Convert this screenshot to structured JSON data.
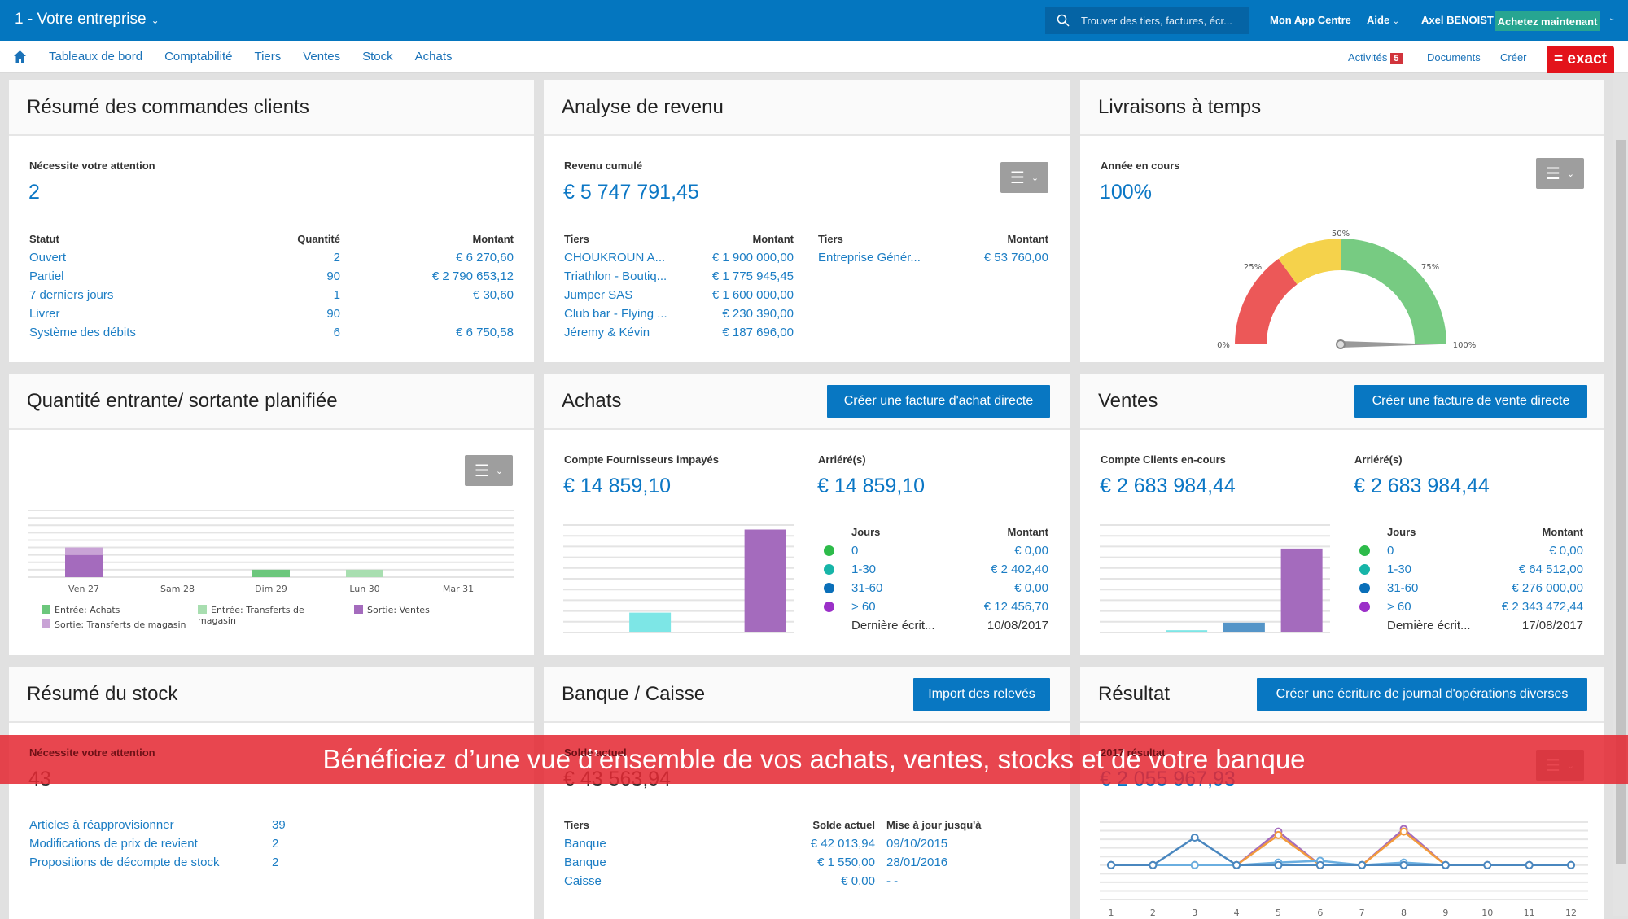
{
  "topbar": {
    "company": "1 - Votre entreprise",
    "search_placeholder": "Trouver des tiers, factures, écr...",
    "app_centre": "Mon App Centre",
    "help": "Aide",
    "user": "Axel BENOIST",
    "buy": "Achetez maintenant"
  },
  "nav": {
    "items": [
      "Tableaux de bord",
      "Comptabilité",
      "Tiers",
      "Ventes",
      "Stock",
      "Achats"
    ],
    "activities": "Activités",
    "activities_count": "5",
    "documents": "Documents",
    "create": "Créer",
    "logo": "= exact"
  },
  "orders": {
    "title": "Résumé des commandes clients",
    "label": "Nécessite votre attention",
    "value": "2",
    "headers": [
      "Statut",
      "Quantité",
      "Montant"
    ],
    "rows": [
      {
        "status": "Ouvert",
        "qty": "2",
        "amount": "€ 6 270,60"
      },
      {
        "status": "Partiel",
        "qty": "90",
        "amount": "€ 2 790 653,12"
      },
      {
        "status": "7 derniers jours",
        "qty": "1",
        "amount": "€ 30,60"
      },
      {
        "status": "Livrer",
        "qty": "90",
        "amount": ""
      },
      {
        "status": "Système des débits",
        "qty": "6",
        "amount": "€ 6 750,58"
      }
    ]
  },
  "revenue": {
    "title": "Analyse de revenu",
    "label": "Revenu cumulé",
    "value": "€ 5 747 791,45",
    "headers": [
      "Tiers",
      "Montant"
    ],
    "left": [
      {
        "name": "CHOUKROUN A...",
        "amount": "€ 1 900 000,00"
      },
      {
        "name": "Triathlon - Boutiq...",
        "amount": "€ 1 775 945,45"
      },
      {
        "name": "Jumper SAS",
        "amount": "€ 1 600 000,00"
      },
      {
        "name": "Club bar - Flying ...",
        "amount": "€ 230 390,00"
      },
      {
        "name": "Jéremy & Kévin",
        "amount": "€ 187 696,00"
      }
    ],
    "right": [
      {
        "name": "Entreprise Génér...",
        "amount": "€ 53 760,00"
      }
    ]
  },
  "delivery": {
    "title": "Livraisons à temps",
    "label": "Année en cours",
    "value": "100%",
    "gauge": {
      "value": 100,
      "ticks": [
        "0%",
        "25%",
        "50%",
        "75%",
        "100%"
      ],
      "segments": [
        {
          "from": 0,
          "to": 30,
          "color": "#ec5858"
        },
        {
          "from": 30,
          "to": 50,
          "color": "#f5d24b"
        },
        {
          "from": 50,
          "to": 100,
          "color": "#77cb82"
        }
      ]
    }
  },
  "planned": {
    "title": "Quantité entrante/ sortante planifiée",
    "legend": [
      "Entrée: Achats",
      "Entrée: Transferts de magasin",
      "Sortie: Ventes",
      "Sortie: Transferts de magasin"
    ]
  },
  "purchases": {
    "title": "Achats",
    "button": "Créer une facture d'achat directe",
    "label": "Compte Fournisseurs impayés",
    "value": "€ 14 859,10",
    "overdue_label": "Arriéré(s)",
    "overdue_value": "€ 14 859,10",
    "headers": [
      "Jours",
      "Montant"
    ],
    "rows": [
      {
        "days": "0",
        "amount": "€ 0,00"
      },
      {
        "days": "1-30",
        "amount": "€ 2 402,40"
      },
      {
        "days": "31-60",
        "amount": "€ 0,00"
      },
      {
        "days": "> 60",
        "amount": "€ 12 456,70"
      }
    ],
    "last_label": "Dernière écrit...",
    "last_date": "10/08/2017"
  },
  "sales": {
    "title": "Ventes",
    "button": "Créer une facture de vente directe",
    "label": "Compte Clients en-cours",
    "value": "€ 2 683 984,44",
    "overdue_label": "Arriéré(s)",
    "overdue_value": "€ 2 683 984,44",
    "headers": [
      "Jours",
      "Montant"
    ],
    "rows": [
      {
        "days": "0",
        "amount": "€ 0,00"
      },
      {
        "days": "1-30",
        "amount": "€ 64 512,00"
      },
      {
        "days": "31-60",
        "amount": "€ 276 000,00"
      },
      {
        "days": "> 60",
        "amount": "€ 2 343 472,44"
      }
    ],
    "last_label": "Dernière écrit...",
    "last_date": "17/08/2017"
  },
  "aging_colors": [
    "#2dbb4a",
    "#17b5a8",
    "#0a6fb9",
    "#9b30c8"
  ],
  "stock": {
    "title": "Résumé du stock",
    "label": "Nécessite votre attention",
    "value": "43",
    "rows": [
      {
        "name": "Articles à réapprovisionner",
        "count": "39"
      },
      {
        "name": "Modifications de prix de revient",
        "count": "2"
      },
      {
        "name": "Propositions de décompte de stock",
        "count": "2"
      }
    ]
  },
  "bank": {
    "title": "Banque / Caisse",
    "button": "Import des relevés",
    "label": "Solde actuel",
    "value": "€ 43 563,94",
    "headers": [
      "Tiers",
      "Solde actuel",
      "Mise à jour jusqu'à"
    ],
    "rows": [
      {
        "name": "Banque",
        "balance": "€ 42 013,94",
        "date": "09/10/2015"
      },
      {
        "name": "Banque",
        "balance": "€ 1 550,00",
        "date": "28/01/2016"
      },
      {
        "name": "Caisse",
        "balance": "€ 0,00",
        "date": "- -"
      }
    ]
  },
  "result": {
    "title": "Résultat",
    "button": "Créer une écriture de journal d'opérations diverses",
    "label": "2017 résultat",
    "value": "€ 2 055 967,93"
  },
  "banner": "Bénéficiez d’une vue d’ensemble de vos achats, ventes, stocks et de votre banque",
  "chart_data": [
    {
      "type": "bar",
      "stacked": true,
      "categories": [
        "Ven 27",
        "Sam 28",
        "Dim 29",
        "Lun 30",
        "Mar 31"
      ],
      "ylim": [
        0,
        9
      ],
      "grid": true,
      "series": [
        {
          "name": "Entrée: Achats",
          "color": "#6cc77c",
          "values": [
            0,
            0,
            1,
            0,
            0
          ]
        },
        {
          "name": "Entrée: Transferts de magasin",
          "color": "#a8deb0",
          "values": [
            0,
            0,
            0,
            1,
            0
          ]
        },
        {
          "name": "Sortie: Ventes",
          "color": "#a46bbd",
          "values": [
            3,
            0,
            0,
            0,
            0
          ]
        },
        {
          "name": "Sortie: Transferts de magasin",
          "color": "#c9a3d6",
          "values": [
            1,
            0,
            0,
            0,
            0
          ]
        }
      ]
    },
    {
      "type": "bar",
      "title": "Achats - arriérés",
      "categories": [
        "0",
        "1-30",
        "31-60",
        "> 60"
      ],
      "values": [
        0,
        2402.4,
        0,
        12456.7
      ],
      "colors": [
        "#2dbb4a",
        "#7de6e6",
        "#5595c8",
        "#a46bbd"
      ],
      "ylim": [
        0,
        13000
      ],
      "grid": true
    },
    {
      "type": "bar",
      "title": "Ventes - arriérés",
      "categories": [
        "0",
        "1-30",
        "31-60",
        "> 60"
      ],
      "values": [
        0,
        64512,
        276000,
        2343472.44
      ],
      "colors": [
        "#2dbb4a",
        "#7de6e6",
        "#5595c8",
        "#a46bbd"
      ],
      "ylim": [
        0,
        3000000
      ],
      "grid": true
    },
    {
      "type": "line",
      "x": [
        1,
        2,
        3,
        4,
        5,
        6,
        7,
        8,
        9,
        10,
        11,
        12
      ],
      "ylim": [
        -4,
        5
      ],
      "grid": true,
      "series": [
        {
          "color": "#a46bbd",
          "values": [
            0,
            0,
            0,
            0,
            3.9,
            0,
            0,
            4.2,
            0,
            0,
            0,
            0
          ]
        },
        {
          "color": "#f29b3d",
          "values": [
            0,
            0,
            0,
            0,
            3.5,
            0,
            0,
            3.9,
            0,
            0,
            0,
            0
          ]
        },
        {
          "color": "#6aaee0",
          "values": [
            0,
            0,
            0,
            0,
            0.3,
            0.5,
            0,
            0.3,
            0,
            0,
            0,
            0
          ]
        },
        {
          "color": "#4a87bf",
          "values": [
            0,
            0,
            3.2,
            0,
            0,
            0,
            0,
            0,
            0,
            0,
            0,
            0
          ]
        }
      ]
    }
  ]
}
